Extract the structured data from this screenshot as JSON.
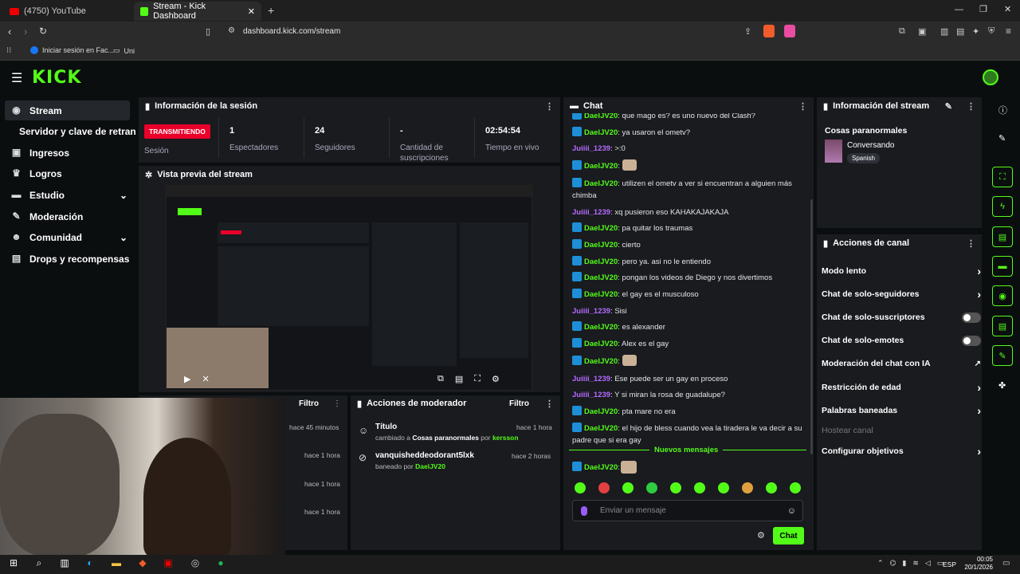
{
  "browser": {
    "tabs": [
      {
        "label": "(4750) YouTube"
      },
      {
        "label": "Stream - Kick Dashboard"
      }
    ],
    "url": "dashboard.kick.com/stream",
    "bookmarks": [
      "Iniciar sesión en Fac...",
      "Uni"
    ]
  },
  "kick": {
    "logo": "KICK"
  },
  "sidebar": {
    "items": [
      {
        "label": "Stream"
      },
      {
        "label": "Servidor y clave de retransmisión"
      },
      {
        "label": "Ingresos"
      },
      {
        "label": "Logros"
      },
      {
        "label": "Estudio"
      },
      {
        "label": "Moderación"
      },
      {
        "label": "Comunidad"
      },
      {
        "label": "Drops y recompensas"
      }
    ]
  },
  "session": {
    "title": "Información de la sesión",
    "live_badge": "TRANSMITIENDO",
    "session_label": "Sesión",
    "stats": [
      {
        "value": "1",
        "label": "Espectadores"
      },
      {
        "value": "24",
        "label": "Seguidores"
      },
      {
        "value": "-",
        "label": "Cantidad de suscripciones"
      },
      {
        "value": "02:54:54",
        "label": "Tiempo en vivo"
      }
    ]
  },
  "preview": {
    "title": "Vista previa del stream"
  },
  "activity": {
    "filter": "Filtro",
    "times": [
      "hace 45 minutos",
      "hace 1 hora",
      "hace 1 hora",
      "hace 1 hora"
    ]
  },
  "modactions": {
    "title": "Acciones de moderador",
    "filter": "Filtro",
    "items": [
      {
        "title": "Título",
        "desc_pre": "cambiado a ",
        "desc_bold": "Cosas paranormales",
        "desc_mid": " por ",
        "desc_user": "kersson",
        "time": "hace 1 hora"
      },
      {
        "title": "vanquisheddeodorant5lxk",
        "desc_pre": "baneado por ",
        "desc_user": "DaelJV20",
        "time": "hace 2 horas"
      }
    ]
  },
  "chat": {
    "title": "Chat",
    "messages": [
      {
        "user": "DaelJV20",
        "text": "que mago es? es uno nuevo del Clash?",
        "color": "green"
      },
      {
        "user": "DaelJV20",
        "text": "ya usaron el ometv?",
        "color": "green"
      },
      {
        "user": "Juiiii_1239",
        "text": ">:0",
        "color": "purple"
      },
      {
        "user": "DaelJV20",
        "text": "",
        "color": "green"
      },
      {
        "user": "DaelJV20",
        "text": "utilizen el ometv a ver si encuentran a alguien más chimba",
        "color": "green"
      },
      {
        "user": "Juiiii_1239",
        "text": "xq pusieron eso KAHAKAJAKAJA",
        "color": "purple"
      },
      {
        "user": "DaelJV20",
        "text": "pa quitar los traumas",
        "color": "green"
      },
      {
        "user": "DaelJV20",
        "text": "cierto",
        "color": "green"
      },
      {
        "user": "DaelJV20",
        "text": "pero ya. asi no le entiendo",
        "color": "green"
      },
      {
        "user": "DaelJV20",
        "text": "pongan los videos de Diego y nos divertimos",
        "color": "green"
      },
      {
        "user": "DaelJV20",
        "text": "el gay es el musculoso",
        "color": "green"
      },
      {
        "user": "Juiiii_1239",
        "text": "Sisi",
        "color": "purple"
      },
      {
        "user": "DaelJV20",
        "text": "es alexander",
        "color": "green"
      },
      {
        "user": "DaelJV20",
        "text": "Alex es el gay",
        "color": "green"
      },
      {
        "user": "DaelJV20",
        "text": "",
        "color": "green"
      },
      {
        "user": "Juiiii_1239",
        "text": "Ese puede ser un gay en proceso",
        "color": "purple"
      },
      {
        "user": "Juiiii_1239",
        "text": "Y si miran la rosa de guadalupe?",
        "color": "purple"
      },
      {
        "user": "DaelJV20",
        "text": "pta mare no era",
        "color": "green"
      },
      {
        "user": "DaelJV20",
        "text": "el hijo de bless cuando vea la tiradera le va decir a su padre que si era gay",
        "color": "green"
      }
    ],
    "new_messages": "Nuevos mensajes",
    "last": {
      "user": "DaelJV20"
    },
    "placeholder": "Enviar un mensaje",
    "send_label": "Chat"
  },
  "streaminfo": {
    "title": "Información del stream",
    "stream_title": "Cosas paranormales",
    "category": "Conversando",
    "language": "Spanish"
  },
  "channel_actions": {
    "title": "Acciones de canal",
    "items": [
      {
        "label": "Modo lento",
        "control": "chevron"
      },
      {
        "label": "Chat de solo-seguidores",
        "control": "chevron"
      },
      {
        "label": "Chat de solo-suscriptores",
        "control": "toggle"
      },
      {
        "label": "Chat de solo-emotes",
        "control": "toggle"
      },
      {
        "label": "Moderación del chat con IA",
        "control": "external"
      },
      {
        "label": "Restricción de edad",
        "control": "chevron"
      },
      {
        "label": "Palabras baneadas",
        "control": "chevron"
      },
      {
        "label": "Hostear canal",
        "control": "none"
      },
      {
        "label": "Configurar objetivos",
        "control": "chevron"
      }
    ]
  },
  "taskbar": {
    "lang": "ESP",
    "time": "00:05",
    "date": "20/1/2026"
  },
  "colors": {
    "accent": "#53fc18",
    "live": "#e8002a",
    "panel": "#191b1f",
    "bg": "#0b0e0f"
  }
}
